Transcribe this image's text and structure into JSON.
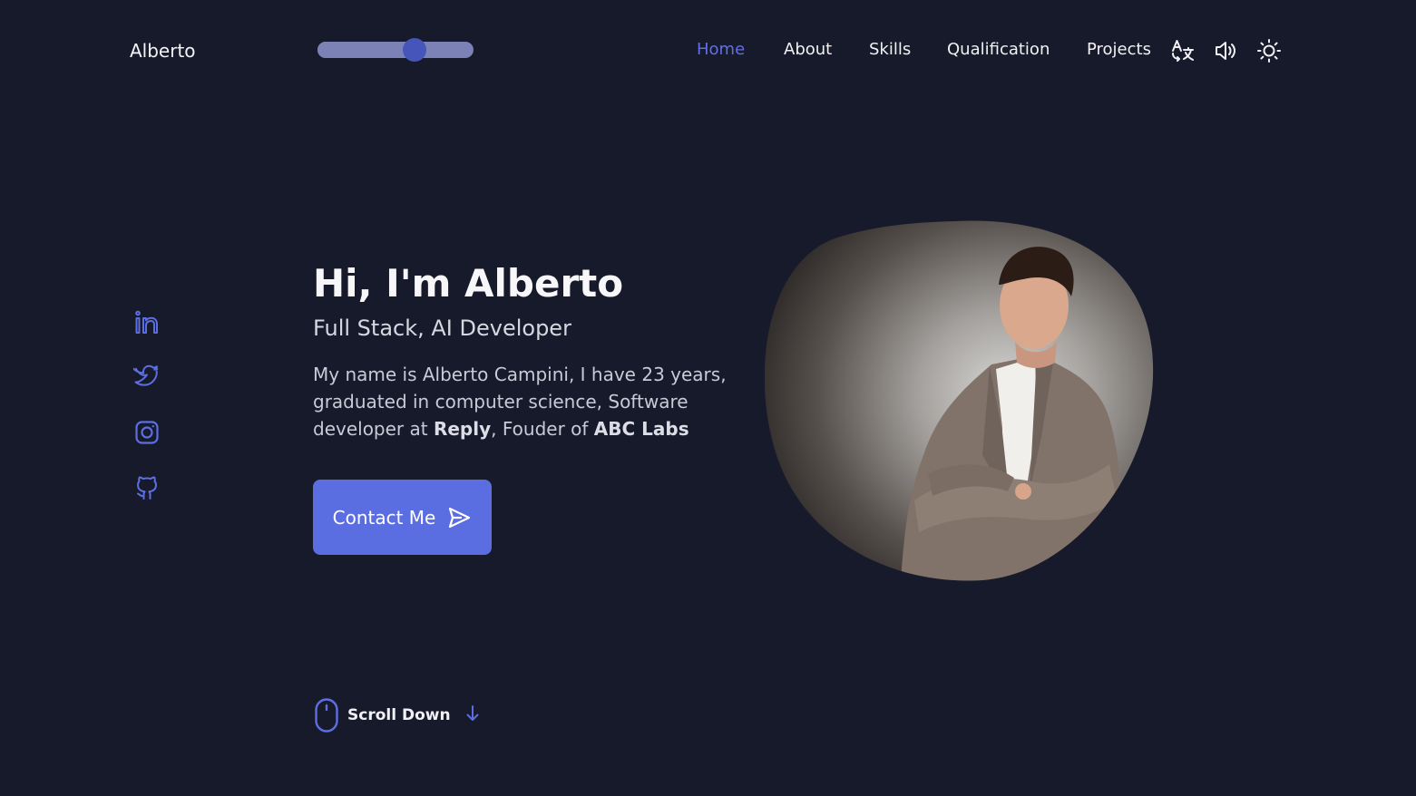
{
  "header": {
    "logo": "Alberto",
    "slider_value": 0.62,
    "nav": [
      {
        "label": "Home",
        "active": true
      },
      {
        "label": "About",
        "active": false
      },
      {
        "label": "Skills",
        "active": false
      },
      {
        "label": "Qualification",
        "active": false
      },
      {
        "label": "Projects",
        "active": false
      }
    ],
    "icons": [
      "translate-icon",
      "volume-icon",
      "sun-icon"
    ]
  },
  "socials": [
    "linkedin-icon",
    "twitter-icon",
    "instagram-icon",
    "github-icon"
  ],
  "hero": {
    "title": "Hi, I'm Alberto",
    "subtitle": "Full Stack, AI Developer",
    "desc_1": "My name is Alberto Campini, I have 23 years, graduated in computer science, Software developer at ",
    "desc_bold_1": "Reply",
    "desc_2": ", Fouder of ",
    "desc_bold_2": "ABC Labs",
    "cta": "Contact Me"
  },
  "scroll": {
    "label": "Scroll Down"
  },
  "colors": {
    "background": "#171a2a",
    "accent": "#5b6ee1",
    "nav_active": "#6070e4",
    "icon": "#5d6fe0"
  }
}
